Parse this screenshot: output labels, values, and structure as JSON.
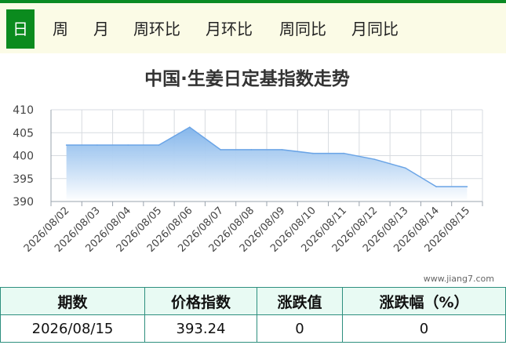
{
  "tabs": [
    "日",
    "周",
    "月",
    "周环比",
    "月环比",
    "周同比",
    "月同比"
  ],
  "active_tab": 0,
  "watermark": "www.jiang7.com",
  "table": {
    "headers": [
      "期数",
      "价格指数",
      "涨跌值",
      "涨跌幅（%）"
    ],
    "row": [
      "2026/08/15",
      "393.24",
      "0",
      "0"
    ]
  },
  "colors": {
    "accent": "#0b8b1e",
    "area_top": "#7fb3ea",
    "area_bottom": "#ffffff",
    "line": "#6aa4e6"
  },
  "chart_data": {
    "type": "area",
    "title": "中国·生姜日定基指数走势",
    "x": [
      "2026/08/02",
      "2026/08/03",
      "2026/08/04",
      "2026/08/05",
      "2026/08/06",
      "2026/08/07",
      "2026/08/08",
      "2026/08/09",
      "2026/08/10",
      "2026/08/11",
      "2026/08/12",
      "2026/08/13",
      "2026/08/14",
      "2026/08/15"
    ],
    "values": [
      402.3,
      402.3,
      402.3,
      402.3,
      406.2,
      401.3,
      401.3,
      401.3,
      400.5,
      400.5,
      399.2,
      397.3,
      393.24,
      393.24
    ],
    "ylim": [
      390,
      410
    ],
    "yticks": [
      390,
      395,
      400,
      405,
      410
    ],
    "grid": true,
    "legend": "none"
  }
}
